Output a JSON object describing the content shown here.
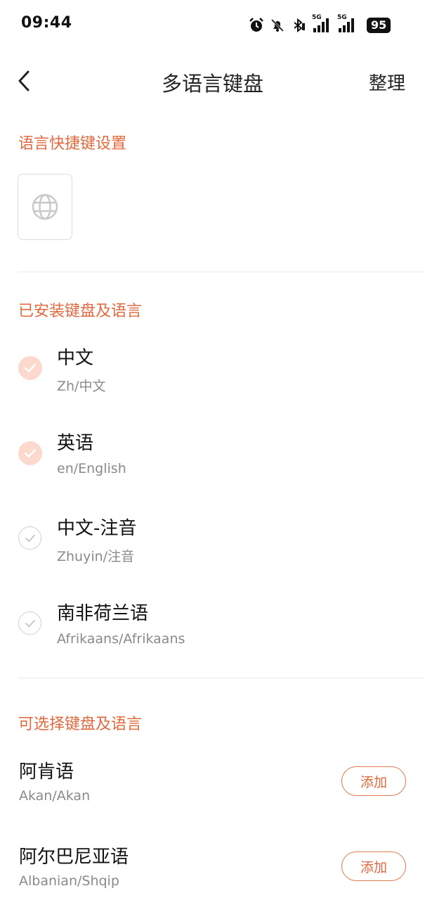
{
  "status_bar": {
    "time": "09:44",
    "net1": "5G",
    "net2": "5G",
    "battery": "95"
  },
  "header": {
    "title": "多语言键盘",
    "manage": "整理"
  },
  "shortcut_section": {
    "title": "语言快捷键设置",
    "icon": "globe-icon"
  },
  "installed": {
    "title": "已安装键盘及语言",
    "items": [
      {
        "name": "中文",
        "sub": "Zh/中文",
        "checked": true
      },
      {
        "name": "英语",
        "sub": "en/English",
        "checked": true
      },
      {
        "name": "中文-注音",
        "sub": "Zhuyin/注音",
        "checked": false
      },
      {
        "name": "南非荷兰语",
        "sub": "Afrikaans/Afrikaans",
        "checked": false
      }
    ]
  },
  "available": {
    "title": "可选择键盘及语言",
    "items": [
      {
        "name": "阿肯语",
        "sub": "Akan/Akan",
        "add": "添加"
      },
      {
        "name": "阿尔巴尼亚语",
        "sub": "Albanian/Shqip",
        "add": "添加"
      }
    ]
  },
  "colors": {
    "accent": "#e06a3f",
    "checked_bg": "#fbd9cc",
    "subtext": "#8a8a8a"
  }
}
